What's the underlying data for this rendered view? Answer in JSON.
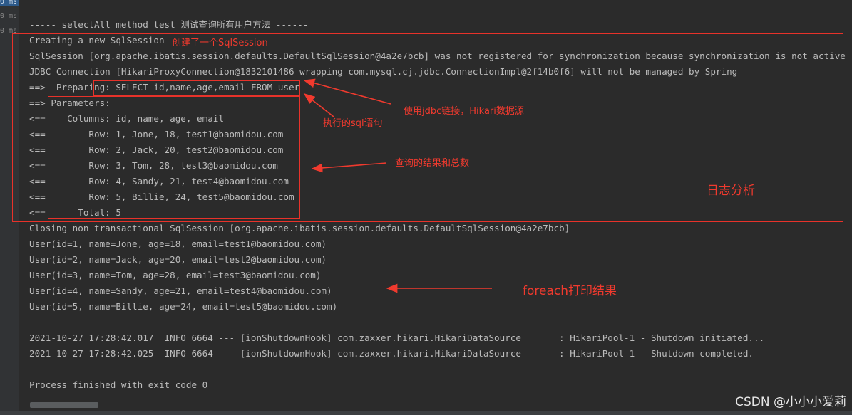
{
  "gutter": {
    "timings": [
      "0 ms",
      "0 ms",
      "0 ms"
    ]
  },
  "console": {
    "lines": [
      "----- selectAll method test 测试查询所有用户方法 ------",
      "Creating a new SqlSession",
      "SqlSession [org.apache.ibatis.session.defaults.DefaultSqlSession@4a2e7bcb] was not registered for synchronization because synchronization is not active",
      "JDBC Connection [HikariProxyConnection@1832101486 wrapping com.mysql.cj.jdbc.ConnectionImpl@2f14b0f6] will not be managed by Spring",
      "==>  Preparing: SELECT id,name,age,email FROM user",
      "==> Parameters: ",
      "<==    Columns: id, name, age, email",
      "<==        Row: 1, Jone, 18, test1@baomidou.com",
      "<==        Row: 2, Jack, 20, test2@baomidou.com",
      "<==        Row: 3, Tom, 28, test3@baomidou.com",
      "<==        Row: 4, Sandy, 21, test4@baomidou.com",
      "<==        Row: 5, Billie, 24, test5@baomidou.com",
      "<==      Total: 5",
      "Closing non transactional SqlSession [org.apache.ibatis.session.defaults.DefaultSqlSession@4a2e7bcb]",
      "User(id=1, name=Jone, age=18, email=test1@baomidou.com)",
      "User(id=2, name=Jack, age=20, email=test2@baomidou.com)",
      "User(id=3, name=Tom, age=28, email=test3@baomidou.com)",
      "User(id=4, name=Sandy, age=21, email=test4@baomidou.com)",
      "User(id=5, name=Billie, age=24, email=test5@baomidou.com)",
      "",
      "2021-10-27 17:28:42.017  INFO 6664 --- [ionShutdownHook] com.zaxxer.hikari.HikariDataSource       : HikariPool-1 - Shutdown initiated...",
      "2021-10-27 17:28:42.025  INFO 6664 --- [ionShutdownHook] com.zaxxer.hikari.HikariDataSource       : HikariPool-1 - Shutdown completed.",
      "",
      "Process finished with exit code 0"
    ]
  },
  "annotations": {
    "create_session": "创建了一个SqlSession",
    "jdbc_hikari": "使用jdbc链接，Hikari数据源",
    "sql_statement": "执行的sql语句",
    "query_result": "查询的结果和总数",
    "log_analysis": "日志分析",
    "foreach_print": "foreach打印结果"
  },
  "watermark": "CSDN @小小小爱莉",
  "colors": {
    "background": "#2b2b2b",
    "text": "#bbbbbb",
    "annotation_red": "#f03a2e"
  }
}
